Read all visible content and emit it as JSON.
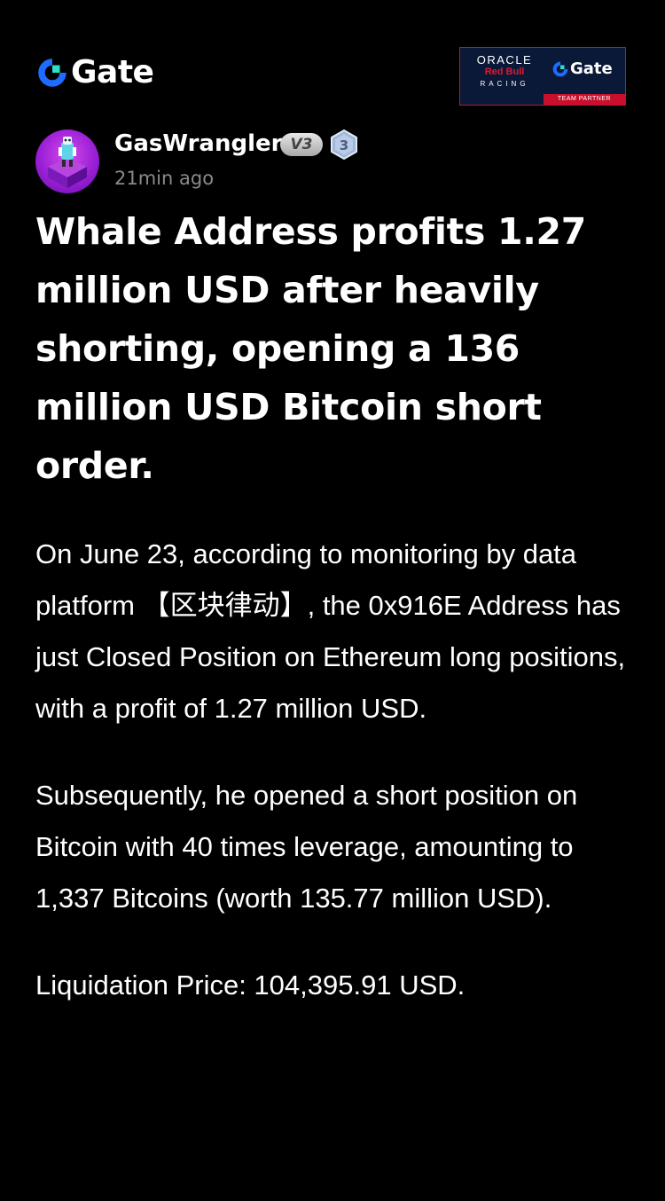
{
  "brand": {
    "name": "Gate",
    "logo_icon": "gate-logo-icon",
    "accent_blue": "#1e6cff",
    "accent_cyan": "#2be0c6"
  },
  "partner": {
    "line1": "ORACLE",
    "line2": "Red Bull",
    "line3": "RACING",
    "brand": "Gate",
    "strip": "TEAM PARTNER",
    "background": "#0b1939",
    "accent_red": "#c8102e"
  },
  "author": {
    "name": "GasWrangler",
    "vip_label": "V3",
    "level": "3",
    "posted": "21min ago",
    "avatar_icon": "avatar-image"
  },
  "article": {
    "title": "Whale Address profits 1.27 million USD after heavily shorting, opening a 136 million USD Bitcoin short order.",
    "paragraphs": [
      "On June 23, according to monitoring by data platform 【区块律动】, the 0x916E Address has just Closed Position on Ethereum long positions, with a profit of 1.27 million USD.",
      "Subsequently, he opened a short position on Bitcoin with 40 times leverage, amounting to 1,337 Bitcoins (worth 135.77 million USD).",
      "Liquidation Price: 104,395.91 USD."
    ]
  }
}
